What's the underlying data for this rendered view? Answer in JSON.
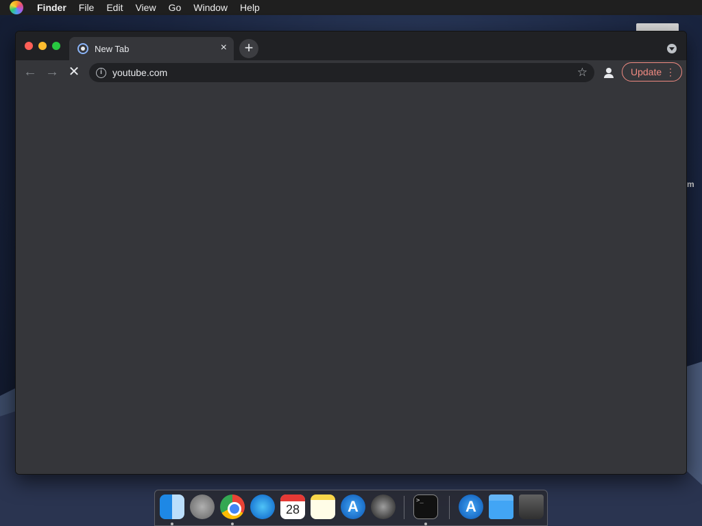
{
  "menubar": {
    "items": [
      "Finder",
      "File",
      "Edit",
      "View",
      "Go",
      "Window",
      "Help"
    ]
  },
  "desktop": {
    "partial_label": "m"
  },
  "browser": {
    "tab": {
      "title": "New Tab",
      "close_glyph": "×"
    },
    "new_tab_glyph": "+",
    "toolbar": {
      "back_glyph": "←",
      "forward_glyph": "→",
      "stop_glyph": "✕",
      "url": "youtube.com",
      "info_glyph": "i",
      "star_glyph": "☆",
      "update_label": "Update",
      "menu_glyph": "⋮"
    }
  },
  "dock": {
    "apps": [
      "Finder",
      "Launchpad",
      "Google Chrome",
      "Safari",
      "Calendar",
      "Notes",
      "App Store",
      "System Preferences",
      "Terminal",
      "Applications",
      "Downloads",
      "Trash"
    ],
    "calendar_day": "28",
    "terminal_prompt": ">_"
  },
  "colors": {
    "accent_update": "#f28b82",
    "window_bg": "#35363a",
    "tabstrip_bg": "#202124"
  }
}
